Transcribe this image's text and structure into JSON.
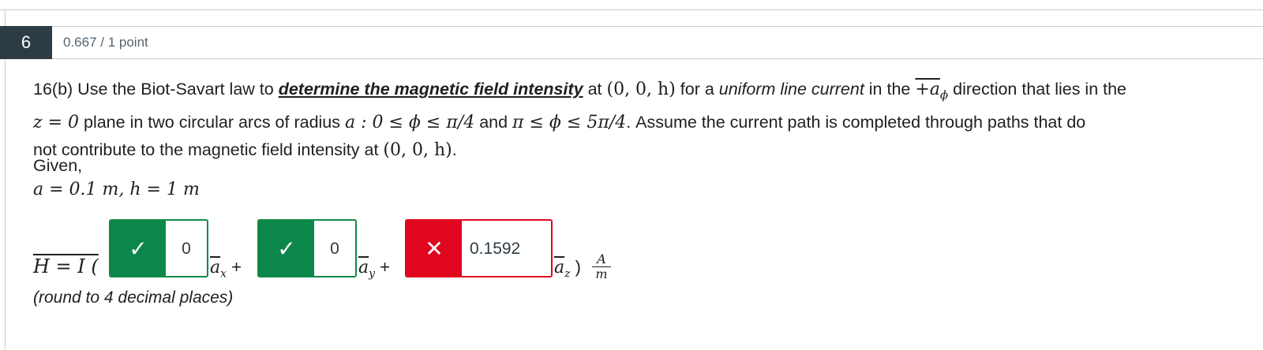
{
  "question": {
    "number": "6",
    "points": "0.667 / 1 point",
    "line1": {
      "prefix": "16(b) Use the Biot-Savart law to ",
      "emph": "determine the magnetic field intensity",
      "at": " at ",
      "point": "(0, 0, h)",
      "for": "  for a ",
      "uniform": "uniform line current",
      "dir_pre": " in the ",
      "dir_math": "+a",
      "dir_sub": "ϕ",
      "dir_post": "  direction that lies in the"
    },
    "line2": {
      "plane_math": "z = 0",
      "text1": " plane in two circular arcs of radius ",
      "radius_math": "a : 0 ≤ ϕ ≤ π/4",
      "and": " and ",
      "range_math": "π ≤ ϕ ≤ 5π/4",
      "text2": ". Assume the current path is completed through paths that do"
    },
    "line3": {
      "text": "not contribute to the magnetic field intensity at ",
      "point": "(0, 0, h)",
      "end": "."
    },
    "given_label": "Given,",
    "given_values": "a = 0.1 m,  h = 1 m"
  },
  "answer": {
    "lhs": "H = I (",
    "fields": [
      {
        "value": "0",
        "status": "correct",
        "icon": "check-icon",
        "unit_vec": "a",
        "unit_sub": "x",
        "sep": " +"
      },
      {
        "value": "0",
        "status": "correct",
        "icon": "check-icon",
        "unit_vec": "a",
        "unit_sub": "y",
        "sep": " +"
      },
      {
        "value": "0.1592",
        "status": "incorrect",
        "icon": "x-icon",
        "unit_vec": "a",
        "unit_sub": "z",
        "sep": " )"
      }
    ],
    "units_num": "A",
    "units_den": "m",
    "rounding_hint": "(round to 4 decimal places)"
  },
  "colors": {
    "correct": "#0b874b",
    "incorrect": "#e0061f",
    "question_badge": "#2d3b45"
  }
}
